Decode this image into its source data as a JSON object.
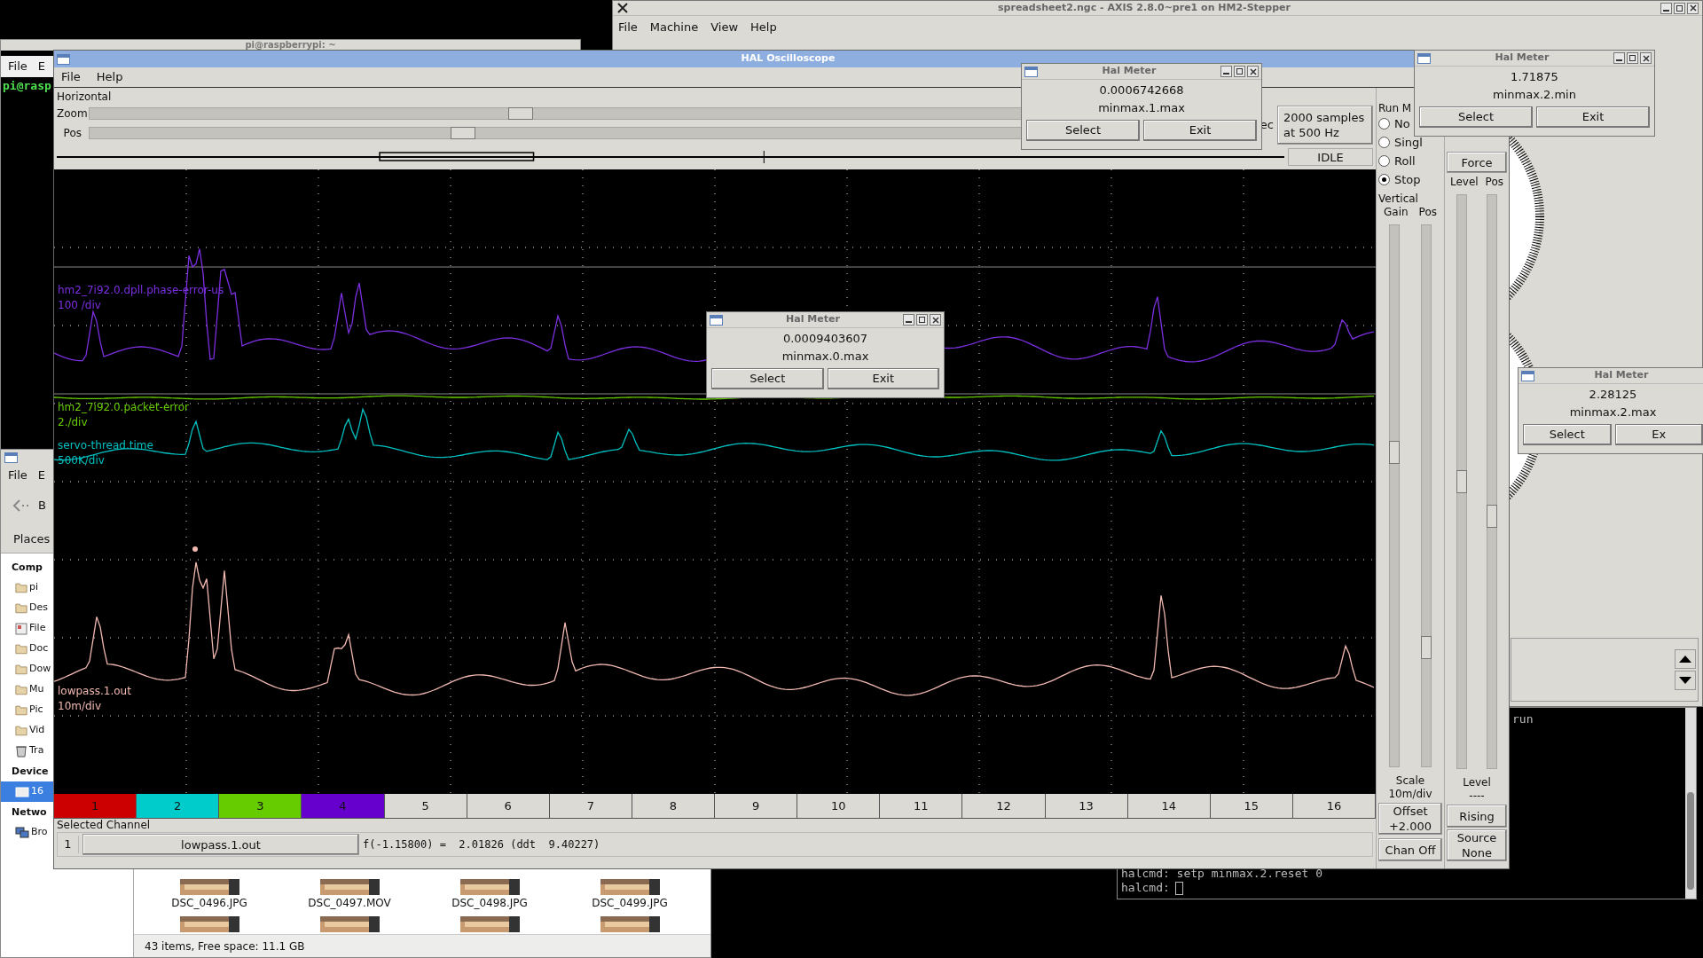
{
  "terminal": {
    "title": "pi@raspberrypi: ~",
    "menu": [
      "File",
      "E"
    ],
    "prompt": "pi@rasp"
  },
  "axis": {
    "title": "spreadsheet2.ngc - AXIS 2.8.0~pre1 on HM2-Stepper",
    "menu": [
      "File",
      "Machine",
      "View",
      "Help"
    ]
  },
  "file_manager": {
    "menu": [
      "File",
      "E"
    ],
    "back": "B",
    "places": "Places",
    "sidebar": [
      {
        "label": "Comp",
        "kind": "heading"
      },
      {
        "label": "pi",
        "kind": "home",
        "selected": false
      },
      {
        "label": "Des",
        "kind": "folder",
        "selected": false
      },
      {
        "label": "File",
        "kind": "filesystem",
        "selected": false
      },
      {
        "label": "Doc",
        "kind": "folder",
        "selected": false
      },
      {
        "label": "Dow",
        "kind": "folder",
        "selected": false
      },
      {
        "label": "Mu",
        "kind": "folder",
        "selected": false
      },
      {
        "label": "Pic",
        "kind": "folder",
        "selected": false
      },
      {
        "label": "Vid",
        "kind": "folder",
        "selected": false
      },
      {
        "label": "Tra",
        "kind": "trash",
        "selected": false
      },
      {
        "label": "Device",
        "kind": "heading"
      },
      {
        "label": "16",
        "kind": "drive",
        "selected": true
      },
      {
        "label": "Netwo",
        "kind": "heading"
      },
      {
        "label": "Bro",
        "kind": "network",
        "selected": false
      }
    ],
    "files": [
      {
        "name": "DSC_0496.JPG"
      },
      {
        "name": "DSC_0497.MOV"
      },
      {
        "name": "DSC_0498.JPG"
      },
      {
        "name": "DSC_0499.JPG"
      }
    ],
    "status": "43 items, Free space: 11.1 GB"
  },
  "oscilloscope": {
    "title": "HAL Oscilloscope",
    "menu": [
      "File",
      "Help"
    ],
    "horizontal": {
      "label": "Horizontal",
      "zoom": {
        "label": "Zoom",
        "level": 0.37
      },
      "pos": {
        "label": "Pos",
        "level": 0.32
      },
      "rec_label": "ec",
      "samples": "2000 samples at 500 Hz",
      "state": "IDLE"
    },
    "run_mode": {
      "label": "Run M",
      "options": [
        {
          "label": "No",
          "selected": false
        },
        {
          "label": "Singl",
          "selected": false
        },
        {
          "label": "Roll",
          "selected": false
        },
        {
          "label": "Stop",
          "selected": true
        }
      ]
    },
    "vertical": {
      "label": "Vertical",
      "gain_label": "Gain",
      "pos_label": "Pos",
      "gain": {
        "level": 0.58
      },
      "pos": {
        "level": 0.22
      },
      "scale": [
        "Scale",
        "10m/div"
      ],
      "offset": [
        "Offset",
        "+2.000"
      ],
      "chan_off": "Chan Off"
    },
    "trigger": {
      "force": "Force",
      "level_label": "Level",
      "pos_label": "Pos",
      "level": {
        "level": 0.5
      },
      "pos": {
        "level": 0.44
      },
      "level_readout": [
        "Level",
        "----"
      ],
      "edge": "Rising",
      "source": [
        "Source",
        "None"
      ]
    },
    "traces": [
      {
        "name": "hm2_7i92.0.dpll.phase-error-us",
        "scale": "100 /div",
        "color": "#7b2fe0"
      },
      {
        "name": "hm2_7i92.0.packet-error",
        "scale": "2./div",
        "color": "#66cc00"
      },
      {
        "name": "servo-thread.time",
        "scale": "500K/div",
        "color": "#00c0c0"
      },
      {
        "name": "lowpass.1.out",
        "scale": "10m/div",
        "color": "#f0b8b0"
      }
    ],
    "channels": [
      {
        "label": "1",
        "color": "#cc0000"
      },
      {
        "label": "2",
        "color": "#00cccc"
      },
      {
        "label": "3",
        "color": "#66cc00"
      },
      {
        "label": "4",
        "color": "#6600cc"
      },
      {
        "label": "5"
      },
      {
        "label": "6"
      },
      {
        "label": "7"
      },
      {
        "label": "8"
      },
      {
        "label": "9"
      },
      {
        "label": "10"
      },
      {
        "label": "11"
      },
      {
        "label": "12"
      },
      {
        "label": "13"
      },
      {
        "label": "14"
      },
      {
        "label": "15"
      },
      {
        "label": "16"
      }
    ],
    "selected_channel": {
      "label": "Selected Channel",
      "number": "1",
      "name": "lowpass.1.out",
      "readout": "f(-1.15800) =  2.01826 (ddt  9.40227)"
    }
  },
  "hal_meters": [
    {
      "title": "Hal Meter",
      "value": "0.0006742668",
      "pin": "minmax.1.max",
      "buttons": [
        "Select",
        "Exit"
      ]
    },
    {
      "title": "Hal Meter",
      "value": "1.71875",
      "pin": "minmax.2.min",
      "buttons": [
        "Select",
        "Exit"
      ]
    },
    {
      "title": "Hal Meter",
      "value": "0.0009403607",
      "pin": "minmax.0.max",
      "buttons": [
        "Select",
        "Exit"
      ]
    },
    {
      "title": "Hal Meter",
      "value": "2.28125",
      "pin": "minmax.2.max",
      "buttons": [
        "Select",
        "Ex"
      ]
    }
  ],
  "halcmd": {
    "lines": [
      "run",
      "halcmd: setp minmax.2.reset 0",
      "halcmd:"
    ]
  }
}
